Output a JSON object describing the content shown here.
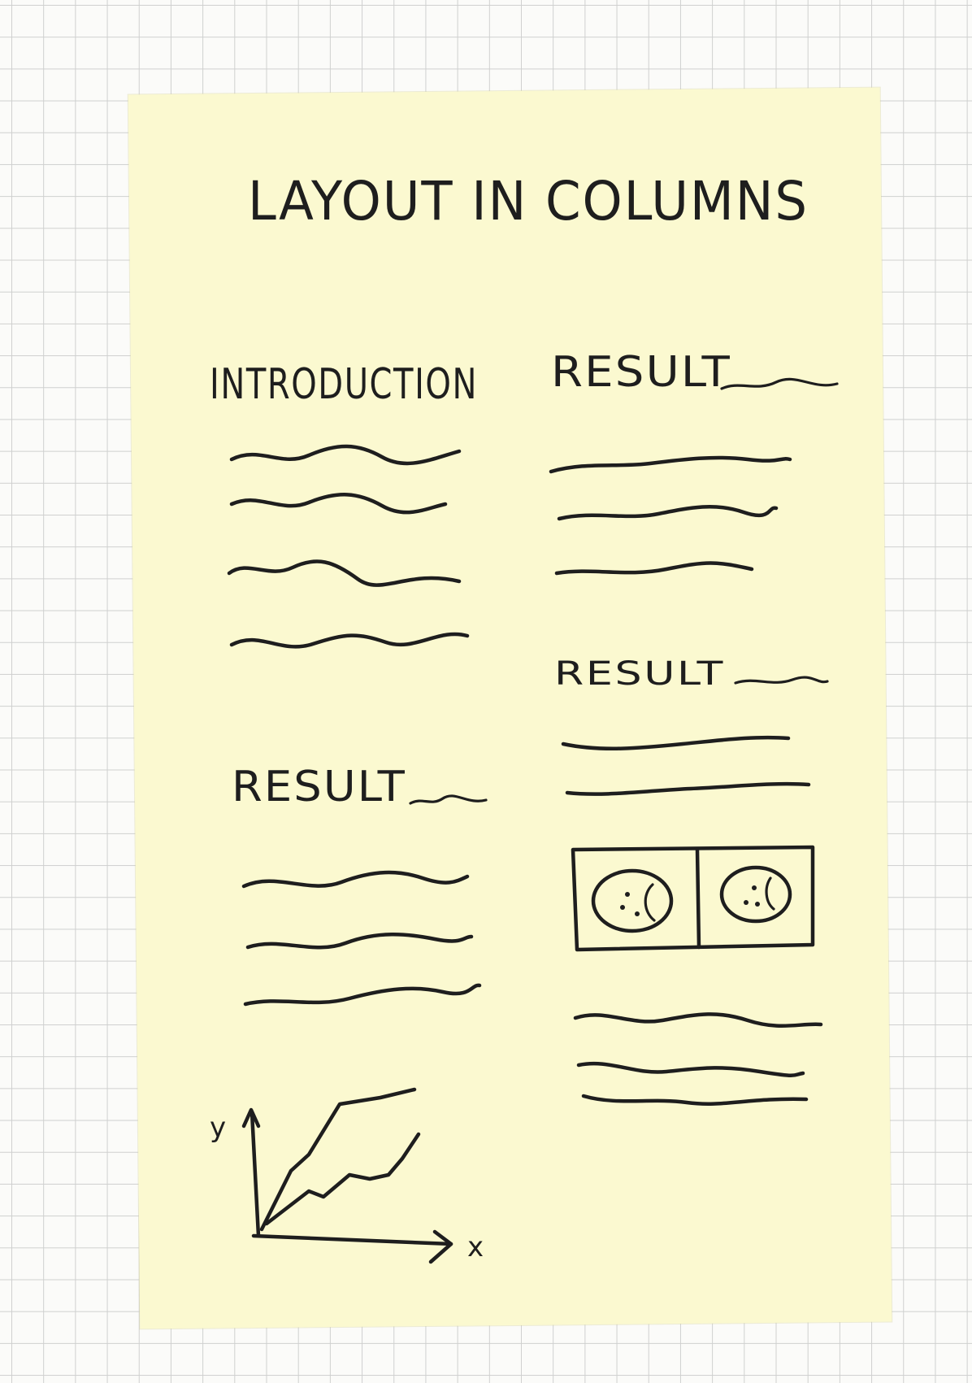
{
  "note": {
    "title": "LAYOUT IN COLUMNS",
    "left_column": {
      "heading_1": "INTRODUCTION",
      "heading_2": "RESULT"
    },
    "right_column": {
      "heading_1": "RESULT",
      "heading_2": "RESULT"
    },
    "chart_sketch": {
      "y_axis_label": "y",
      "x_axis_label": "x"
    },
    "colors": {
      "paper": "#fbf9d0",
      "ink": "#1e1e1e",
      "grid": "#cfd0cf"
    }
  }
}
